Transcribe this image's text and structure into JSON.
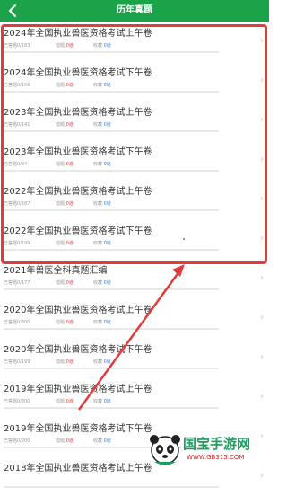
{
  "header": {
    "title": "历年真题"
  },
  "items": [
    {
      "title": "2024年全国执业兽医资格考试上午卷",
      "answered": "已答题0/183",
      "wrong": "0道",
      "collected": "0道"
    },
    {
      "title": "2024年全国执业兽医资格考试下午卷",
      "answered": "已答题0/156",
      "wrong": "0道",
      "collected": "0道"
    },
    {
      "title": "2023年全国执业兽医资格考试上午卷",
      "answered": "已答题0/141",
      "wrong": "0道",
      "collected": "0道"
    },
    {
      "title": "2023年全国执业兽医资格考试下午卷",
      "answered": "已答题0/84",
      "wrong": "0道",
      "collected": "0道"
    },
    {
      "title": "2022年全国执业兽医资格考试上午卷",
      "answered": "已答题0/187",
      "wrong": "0道",
      "collected": "0道"
    },
    {
      "title": "2022年全国执业兽医资格考试下午卷",
      "answered": "已答题0/199",
      "wrong": "0道",
      "collected": "0道"
    },
    {
      "title": "2021年兽医全科真题汇编",
      "answered": "已答题0/177",
      "wrong": "0道",
      "collected": "0道"
    },
    {
      "title": "2020年全国执业兽医资格考试上午卷",
      "answered": "已答题0/200",
      "wrong": "0道",
      "collected": "0道"
    },
    {
      "title": "2020年全国执业兽医资格考试下午卷",
      "answered": "已答题0/199",
      "wrong": "0道",
      "collected": "0道"
    },
    {
      "title": "2019年全国执业兽医资格考试上午卷",
      "answered": "已答题0/200",
      "wrong": "0道",
      "collected": "0道"
    },
    {
      "title": "2019年全国执业兽医资格考试下午卷",
      "answered": "已答题0/200",
      "wrong": "0道",
      "collected": "0道"
    },
    {
      "title": "2018年全国执业兽医资格考试上午卷",
      "answered": "",
      "wrong": "",
      "collected": ""
    }
  ],
  "labels": {
    "wrong": "错题",
    "collected": "收藏"
  },
  "watermark": {
    "text": "国宝手游网",
    "url": "WWW.GB315.COM"
  },
  "colors": {
    "header": "#1ba34a",
    "highlight": "#e23b3b",
    "wrong": "#e23b3b",
    "collected": "#3b7bd8"
  }
}
